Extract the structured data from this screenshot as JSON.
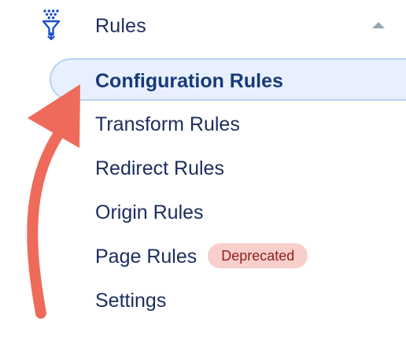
{
  "section": {
    "title": "Rules",
    "icon": "filter-icon",
    "toggle_icon": "chevron-up-icon",
    "expanded": true
  },
  "submenu": {
    "active": {
      "label": "Configuration Rules"
    },
    "items": [
      {
        "label": "Transform Rules"
      },
      {
        "label": "Redirect Rules"
      },
      {
        "label": "Origin Rules"
      },
      {
        "label": "Page Rules",
        "badge": "Deprecated"
      },
      {
        "label": "Settings"
      }
    ]
  },
  "annotation": {
    "icon": "curved-arrow-icon",
    "color": "#ee6b5b"
  },
  "colors": {
    "text": "#1b2d5c",
    "active_bg": "#e8f0fd",
    "active_border": "#b9d2f4",
    "badge_bg": "#f8cfcb",
    "badge_text": "#8d1f1b",
    "icon_blue": "#1e4fcb"
  }
}
